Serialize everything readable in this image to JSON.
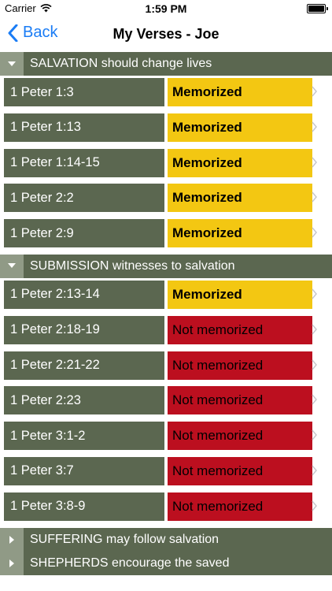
{
  "status": {
    "carrier": "Carrier",
    "time": "1:59 PM"
  },
  "nav": {
    "back_label": "Back",
    "title": "My Verses - Joe"
  },
  "colors": {
    "header": "#5b6750",
    "memorized": "#f3c712",
    "not_memorized": "#bc0f1f",
    "link": "#1a7cf5"
  },
  "sections": [
    {
      "title": "SALVATION should change lives",
      "expanded": true,
      "verses": [
        {
          "ref": "1 Peter 1:3",
          "status": "Memorized"
        },
        {
          "ref": "1 Peter 1:13",
          "status": "Memorized"
        },
        {
          "ref": "1 Peter 1:14-15",
          "status": "Memorized"
        },
        {
          "ref": "1 Peter 2:2",
          "status": "Memorized"
        },
        {
          "ref": "1 Peter 2:9",
          "status": "Memorized"
        }
      ]
    },
    {
      "title": "SUBMISSION witnesses to salvation",
      "expanded": true,
      "verses": [
        {
          "ref": "1 Peter 2:13-14",
          "status": "Memorized"
        },
        {
          "ref": "1 Peter 2:18-19",
          "status": "Not memorized"
        },
        {
          "ref": "1 Peter 2:21-22",
          "status": "Not memorized"
        },
        {
          "ref": "1 Peter 2:23",
          "status": "Not memorized"
        },
        {
          "ref": "1 Peter 3:1-2",
          "status": "Not memorized"
        },
        {
          "ref": "1 Peter 3:7",
          "status": "Not memorized"
        },
        {
          "ref": "1 Peter 3:8-9",
          "status": "Not memorized"
        }
      ]
    },
    {
      "title": "SUFFERING may follow salvation",
      "expanded": false,
      "verses": []
    },
    {
      "title": "SHEPHERDS encourage the saved",
      "expanded": false,
      "verses": []
    }
  ]
}
